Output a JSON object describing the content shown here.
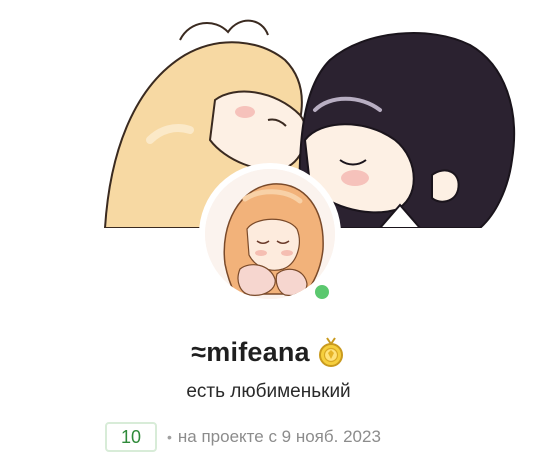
{
  "profile": {
    "username": "≈mifeana",
    "status": "есть любименький",
    "level": "10",
    "since_bullet": "•",
    "since_text": "на проекте с 9 нояб. 2023",
    "online": true,
    "badge_icon": "gold-medal-icon"
  },
  "colors": {
    "online": "#5bc86f",
    "level_text": "#2f8a3a",
    "level_border": "#d8ecd8",
    "muted_text": "#8c8c8c"
  }
}
